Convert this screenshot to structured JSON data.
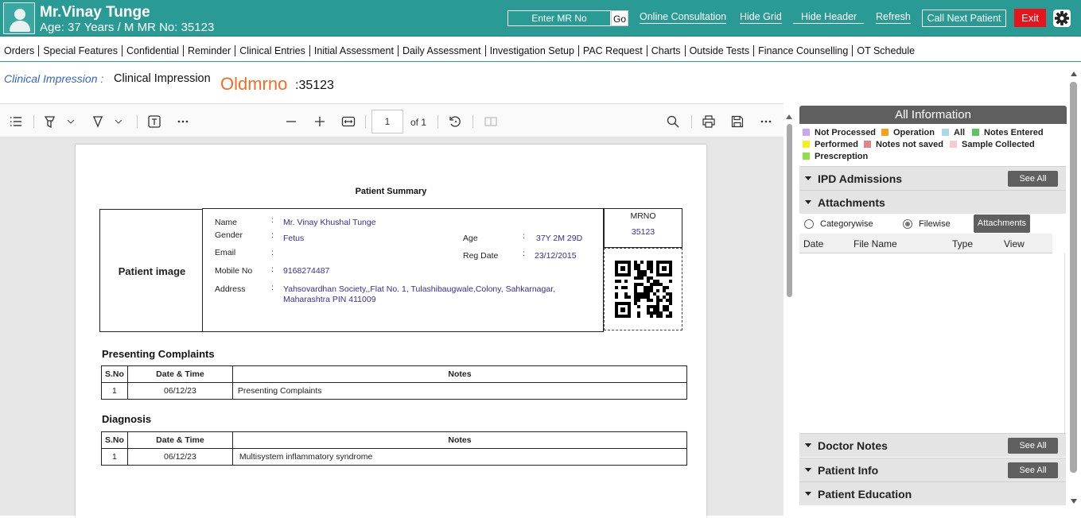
{
  "header": {
    "patient_name": "Mr.Vinay Tunge",
    "patient_info": "Age: 37 Years / M   MR No: 35123",
    "mr_input_placeholder": "Enter MR No",
    "go_label": "Go",
    "links": [
      "Online Consultation",
      "Hide Grid",
      "Hide Header",
      "Refresh"
    ],
    "call_next_label": "Call Next Patient",
    "exit_label": "Exit",
    "exit_color": "#e8141c",
    "header_color": "#2a9a95"
  },
  "menu": [
    "Orders",
    "Special Features",
    "Confidential",
    "Reminder",
    "Clinical Entries",
    "Initial Assessment",
    "Daily Assessment",
    "Investigation Setup",
    "PAC Request",
    "Charts",
    "Outside Tests",
    "Finance Counselling",
    "OT Schedule"
  ],
  "clinical": {
    "label": "Clinical Impression :",
    "value": "Clinical Impression",
    "old_label": "Oldmrno",
    "old_value": ":35123"
  },
  "viewer": {
    "page_number": "1",
    "page_of": "of 1",
    "icons": [
      "list-icon",
      "highlight-icon",
      "chevron-down-icon",
      "draw-icon",
      "chevron-down-icon",
      "text-box-icon",
      "more-icon",
      "zoom-out-icon",
      "zoom-in-icon",
      "fit-width-icon",
      "rotate-icon",
      "two-page-icon",
      "search-icon",
      "print-icon",
      "save-icon",
      "more-icon"
    ]
  },
  "document": {
    "title": "Patient Summary",
    "patient_image_label": "Patient image",
    "details": {
      "name_label": "Name",
      "name_value": "Mr. Vinay Khushal Tunge",
      "gender_label": "Gender",
      "gender_value": "Fetus",
      "email_label": "Email",
      "email_value": "",
      "mobile_label": "Mobile No",
      "mobile_value": "9168274487",
      "address_label": "Address",
      "address_line1": "Yahsovardhan Society,,Flat No. 1, Tulashibaugwale,Colony, Sahkarnagar,",
      "address_line2": "Maharashtra  PIN 411009",
      "age_label": "Age",
      "age_value": "37Y 2M 29D",
      "reg_label": "Reg Date",
      "reg_value": "23/12/2015"
    },
    "mrno_label": "MRNO",
    "mrno_value": "35123",
    "complaints_heading": "Presenting Complaints",
    "diagnosis_heading": "Diagnosis",
    "table_headers": [
      "S.No",
      "Date & Time",
      "Notes"
    ],
    "complaints_rows": [
      [
        "1",
        "06/12/23",
        "Presenting Complaints"
      ]
    ],
    "diagnosis_rows": [
      [
        "1",
        "06/12/23",
        "Multisystem inflammatory syndrome"
      ]
    ]
  },
  "right_panel": {
    "title": "All Information",
    "legend": [
      {
        "label": "Not Processed",
        "color": "#c9a6f0"
      },
      {
        "label": "Operation",
        "color": "#f2a21b"
      },
      {
        "label": "All",
        "color": "#a8d8ea"
      },
      {
        "label": "Notes Entered",
        "color": "#5cc465"
      },
      {
        "label": "Performed",
        "color": "#f3f01a"
      },
      {
        "label": "Notes not saved",
        "color": "#e08585"
      },
      {
        "label": "Sample Collected",
        "color": "#f7c9d0"
      },
      {
        "label": "Prescreption",
        "color": "#8ee04b"
      }
    ],
    "sections": {
      "ipd": "IPD Admissions",
      "attachments": "Attachments",
      "doctor_notes": "Doctor Notes",
      "patient_info": "Patient Info",
      "patient_education": "Patient Education"
    },
    "see_all": "See All",
    "radio_categorywise": "Categorywise",
    "radio_filewise": "Filewise",
    "attachments_button": "Attachments",
    "attachment_columns": [
      "Date",
      "File Name",
      "Type",
      "View"
    ]
  }
}
